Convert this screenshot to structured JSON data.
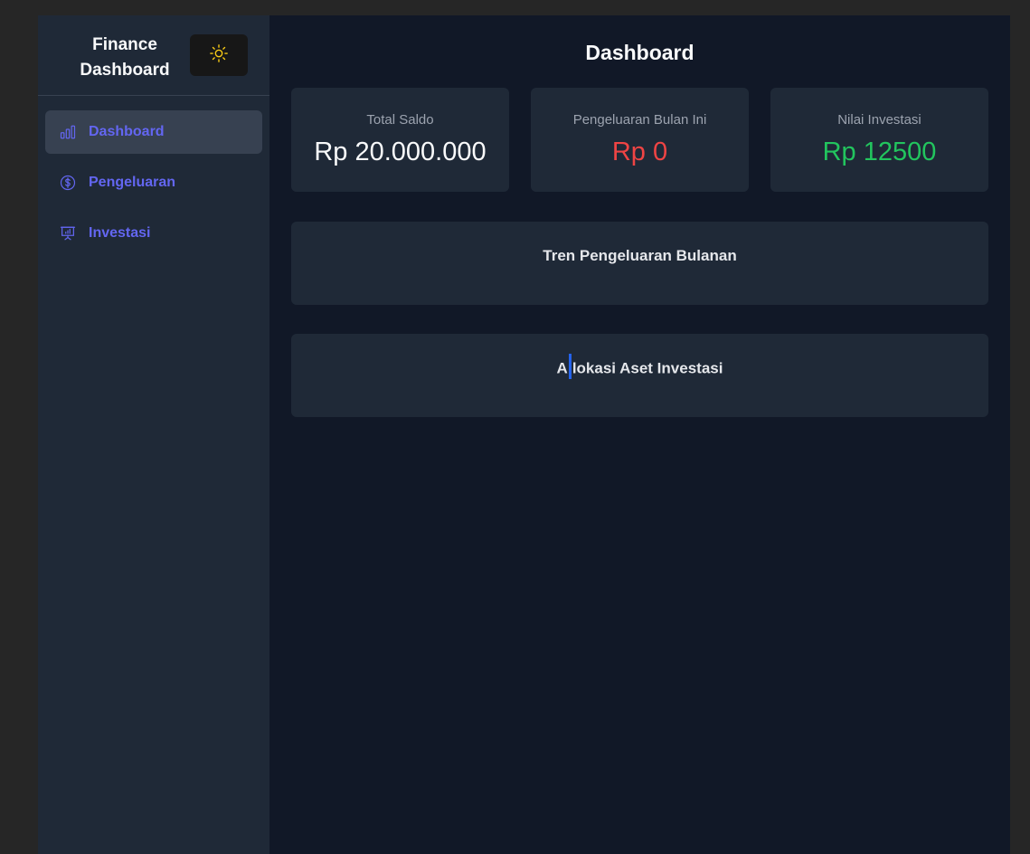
{
  "sidebar": {
    "brand_line1": "Finance",
    "brand_line2": "Dashboard",
    "theme_toggle_icon": "sun-icon",
    "items": [
      {
        "label": "Dashboard",
        "icon": "bar-chart-icon",
        "active": true
      },
      {
        "label": "Pengeluaran",
        "icon": "dollar-circle-icon",
        "active": false
      },
      {
        "label": "Investasi",
        "icon": "presentation-chart-icon",
        "active": false
      }
    ]
  },
  "main": {
    "title": "Dashboard",
    "cards": [
      {
        "label": "Total Saldo",
        "value": "Rp 20.000.000"
      },
      {
        "label": "Pengeluaran Bulan Ini",
        "value": "Rp 0"
      },
      {
        "label": "Nilai Investasi",
        "value": "Rp 12500"
      }
    ],
    "panels": [
      {
        "title": "Tren Pengeluaran Bulanan"
      },
      {
        "title_before_caret": "A",
        "title_after_caret": "lokasi Aset Investasi"
      }
    ]
  },
  "colors": {
    "accent": "#6366f1",
    "negative": "#ef4444",
    "positive": "#22c55e",
    "sun": "#facc15"
  }
}
